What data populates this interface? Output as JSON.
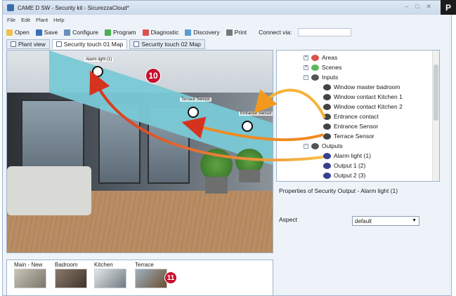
{
  "window": {
    "title": "CAME D SW - Security kit - SicurezzaCloud*",
    "badge": "P",
    "minimize": "–",
    "maximize": "□",
    "close": "✕"
  },
  "menu": [
    "File",
    "Edit",
    "Plant",
    "Help"
  ],
  "toolbar": {
    "open": "Open",
    "save": "Save",
    "configure": "Configure",
    "program": "Program",
    "diagnostic": "Diagnostic",
    "discovery": "Discovery",
    "print": "Print",
    "connect_via": "Connect via:",
    "connect_value": ""
  },
  "tabs": [
    "Plant view",
    "Security touch 01 Map",
    "Security touch 02 Map"
  ],
  "map": {
    "sensors": [
      {
        "label": "Alarm light (1)"
      },
      {
        "label": "Terrace Sensor"
      },
      {
        "label": "Entrance Sensor"
      }
    ],
    "callouts": [
      "10",
      "11"
    ]
  },
  "thumbnails": [
    "Main - New",
    "Badroom",
    "Kitchen",
    "Terrace"
  ],
  "tree": {
    "nodes": [
      {
        "label": "Areas",
        "icon": "areas-icon",
        "color": "#d9534f"
      },
      {
        "label": "Scenes",
        "icon": "scenes-icon",
        "color": "#5cb85c"
      },
      {
        "label": "Inputs",
        "icon": "inputs-icon",
        "color": "#555555"
      },
      {
        "label": "Window master badroom",
        "icon": "sensor-icon",
        "color": "#444444"
      },
      {
        "label": "Window contact Kitchen 1",
        "icon": "sensor-icon",
        "color": "#444444"
      },
      {
        "label": "Window contact Kitchen 2",
        "icon": "sensor-icon",
        "color": "#444444"
      },
      {
        "label": "Entrance contact",
        "icon": "sensor-icon",
        "color": "#444444"
      },
      {
        "label": "Entrance Sensor",
        "icon": "sensor-icon",
        "color": "#444444"
      },
      {
        "label": "Terrace Sensor",
        "icon": "sensor-icon",
        "color": "#444444"
      },
      {
        "label": "Outputs",
        "icon": "outputs-icon",
        "color": "#555555"
      },
      {
        "label": "Alarm light (1)",
        "icon": "output-icon",
        "color": "#3b3f8f"
      },
      {
        "label": "Output 1 (2)",
        "icon": "output-icon",
        "color": "#3b3f8f"
      },
      {
        "label": "Output 2 (3)",
        "icon": "output-icon",
        "color": "#3b3f8f"
      }
    ]
  },
  "properties": {
    "title": "Properties of Security Output - Alarm light (1)",
    "aspect_label": "Aspect",
    "aspect_value": "default"
  },
  "colors": {
    "accent_red": "#c8102e",
    "arrow_orange": "#f39a1e",
    "awning": "#79c9d6"
  }
}
